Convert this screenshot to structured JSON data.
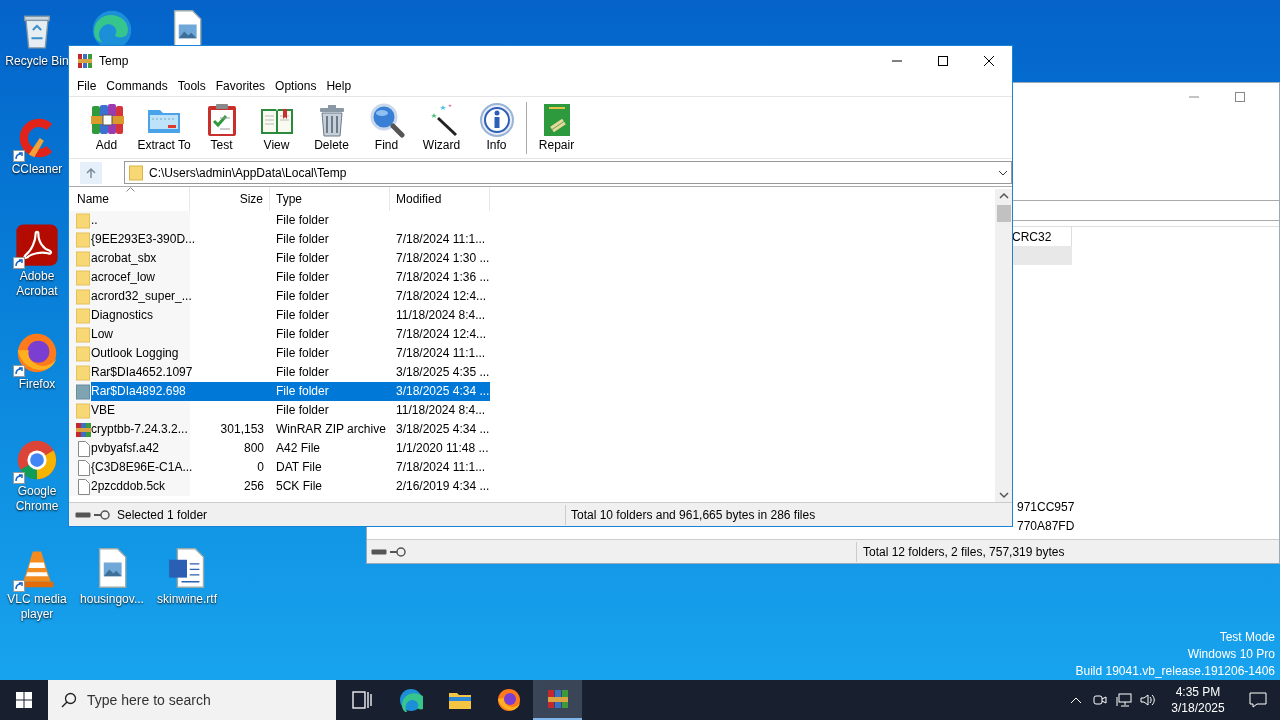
{
  "desktop_icons": [
    {
      "kind": "recycle",
      "label": "Recycle Bin",
      "shortcut": false
    },
    {
      "kind": "edge",
      "shortcut": false
    },
    {
      "kind": "image",
      "shortcut": false
    },
    {
      "kind": "ccleaner",
      "label": "CCleaner",
      "shortcut": true
    },
    {
      "kind": "acrobat",
      "label": "Adobe Acrobat",
      "shortcut": true
    },
    {
      "kind": "firefox",
      "label": "Firefox",
      "shortcut": true
    },
    {
      "kind": "chrome",
      "label": "Google Chrome",
      "shortcut": true
    },
    {
      "kind": "vlc",
      "label": "VLC media player",
      "shortcut": true
    },
    {
      "kind": "image",
      "label": "housingov...",
      "shortcut": false
    },
    {
      "kind": "document",
      "label": "skinwine.rtf",
      "shortcut": false
    }
  ],
  "background_window": {
    "column": "CRC32",
    "values": [
      "971CC957",
      "770A87FD"
    ],
    "status": "Total 12 folders, 2 files, 757,319 bytes"
  },
  "window": {
    "title": "Temp",
    "menu": [
      "File",
      "Commands",
      "Tools",
      "Favorites",
      "Options",
      "Help"
    ],
    "toolbar": [
      {
        "kind": "add",
        "label": "Add"
      },
      {
        "kind": "extract",
        "label": "Extract To"
      },
      {
        "kind": "test",
        "label": "Test"
      },
      {
        "kind": "view",
        "label": "View"
      },
      {
        "kind": "delete",
        "label": "Delete"
      },
      {
        "kind": "find",
        "label": "Find"
      },
      {
        "kind": "wizard",
        "label": "Wizard"
      },
      {
        "kind": "info",
        "label": "Info"
      },
      {
        "kind": "separator"
      },
      {
        "kind": "repair",
        "label": "Repair"
      }
    ],
    "path": "C:\\Users\\admin\\AppData\\Local\\Temp",
    "columns": [
      "Name",
      "Size",
      "Type",
      "Modified"
    ],
    "files": [
      {
        "kind": "folder",
        "name": "..",
        "type": "File folder",
        "selected": false
      },
      {
        "kind": "folder",
        "name": "{9EE293E3-390D...",
        "type": "File folder",
        "modified": "7/18/2024 11:1...",
        "selected": false
      },
      {
        "kind": "folder",
        "name": "acrobat_sbx",
        "type": "File folder",
        "modified": "7/18/2024 1:30 ...",
        "selected": false
      },
      {
        "kind": "folder",
        "name": "acrocef_low",
        "type": "File folder",
        "modified": "7/18/2024 1:36 ...",
        "selected": false
      },
      {
        "kind": "folder",
        "name": "acrord32_super_...",
        "type": "File folder",
        "modified": "7/18/2024 12:4...",
        "selected": false
      },
      {
        "kind": "folder",
        "name": "Diagnostics",
        "type": "File folder",
        "modified": "11/18/2024 8:4...",
        "selected": false
      },
      {
        "kind": "folder",
        "name": "Low",
        "type": "File folder",
        "modified": "7/18/2024 12:4...",
        "selected": false
      },
      {
        "kind": "folder",
        "name": "Outlook Logging",
        "type": "File folder",
        "modified": "7/18/2024 11:1...",
        "selected": false
      },
      {
        "kind": "folder",
        "name": "Rar$DIa4652.1097",
        "type": "File folder",
        "modified": "3/18/2025 4:35 ...",
        "selected": false
      },
      {
        "kind": "folder",
        "name": "Rar$DIa4892.698",
        "type": "File folder",
        "modified": "3/18/2025 4:34 ...",
        "selected": true
      },
      {
        "kind": "folder",
        "name": "VBE",
        "type": "File folder",
        "modified": "11/18/2024 8:4...",
        "selected": false
      },
      {
        "kind": "archive",
        "name": "cryptbb-7.24.3.2...",
        "size": "301,153",
        "type": "WinRAR ZIP archive",
        "modified": "3/18/2025 4:34 ...",
        "selected": false
      },
      {
        "kind": "file",
        "name": "pvbyafsf.a42",
        "size": "800",
        "type": "A42 File",
        "modified": "1/1/2020 11:48 ...",
        "selected": false
      },
      {
        "kind": "file",
        "name": "{C3D8E96E-C1A...",
        "size": "0",
        "type": "DAT File",
        "modified": "7/18/2024 11:1...",
        "selected": false
      },
      {
        "kind": "file",
        "name": "2pzcddob.5ck",
        "size": "256",
        "type": "5CK File",
        "modified": "2/16/2019 4:34 ...",
        "selected": false
      }
    ],
    "status_left": "Selected 1 folder",
    "status_right": "Total 10 folders and 961,665 bytes in 286 files"
  },
  "taskbar": {
    "search_placeholder": "Type here to search",
    "apps": [
      {
        "kind": "taskview",
        "active": false
      },
      {
        "kind": "edge",
        "active": false
      },
      {
        "kind": "explorer",
        "active": false
      },
      {
        "kind": "firefox",
        "active": false
      },
      {
        "kind": "winrar",
        "active": true
      }
    ],
    "time": "4:35 PM",
    "date": "3/18/2025"
  },
  "system_info": [
    "Test Mode",
    "Windows 10 Pro",
    "Build 19041.vb_release.191206-1406"
  ]
}
